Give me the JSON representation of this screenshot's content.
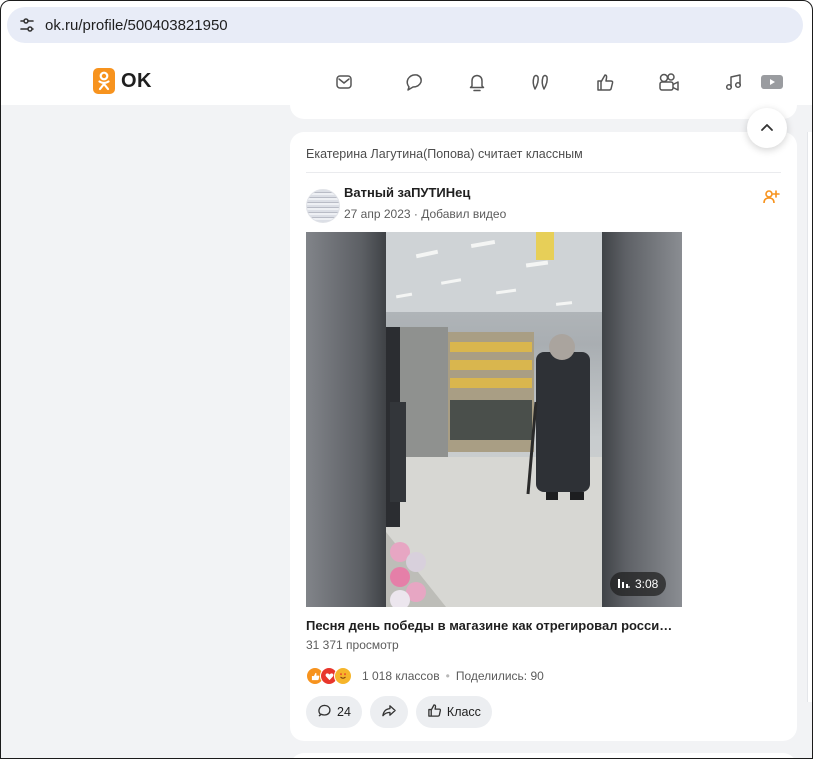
{
  "browser": {
    "url": "ok.ru/profile/500403821950",
    "site_settings_icon": "tune-icon"
  },
  "site": {
    "logo_text": "OK",
    "brand_color": "#f7931e"
  },
  "nav_icons": [
    "messages-icon",
    "discussions-icon",
    "notifications-icon",
    "guests-icon",
    "events-icon",
    "video-icon",
    "music-icon",
    "tv-icon"
  ],
  "feed": {
    "card_header": "Екатерина Лагутина(Попова) считает классным",
    "author": "Ватный заПУТИНец",
    "post_meta": "27 апр 2023 · Добавил видео",
    "video": {
      "duration": "3:08",
      "title": "Песня день победы в магазине как отрегировал росси…",
      "views": "31 371 просмотр"
    },
    "reactions": {
      "icons": [
        "like-reaction-icon",
        "heart-reaction-icon",
        "love-reaction-icon"
      ],
      "likes_text": "1 018 классов",
      "shares_text": "Поделились: 90"
    },
    "actions": {
      "comments_count": "24",
      "class_label": "Класс"
    }
  }
}
